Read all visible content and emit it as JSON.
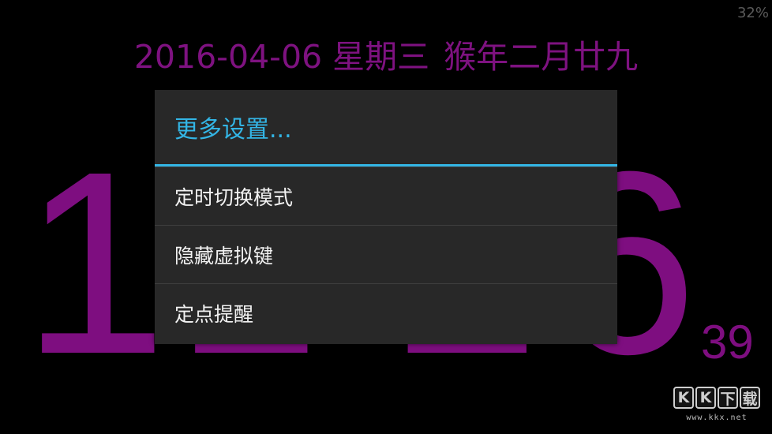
{
  "status": {
    "battery_text": "32%"
  },
  "date_line": {
    "date": "2016-04-06 星期三",
    "lunar": "猴年二月廿九"
  },
  "clock": {
    "digits": [
      "1",
      "1",
      ":",
      "2",
      "6"
    ],
    "seconds": "39"
  },
  "dialog": {
    "title": "更多设置...",
    "items": [
      {
        "label": "定时切换模式"
      },
      {
        "label": "隐藏虚拟键"
      },
      {
        "label": "定点提醒"
      }
    ]
  },
  "watermark": {
    "logo_chars": [
      "K",
      "K",
      "下",
      "载"
    ],
    "url": "www.kkx.net"
  },
  "colors": {
    "clock_purple": "#7e0e80",
    "accent_blue": "#33b5e5",
    "dialog_bg": "#282828",
    "background": "#000000"
  }
}
